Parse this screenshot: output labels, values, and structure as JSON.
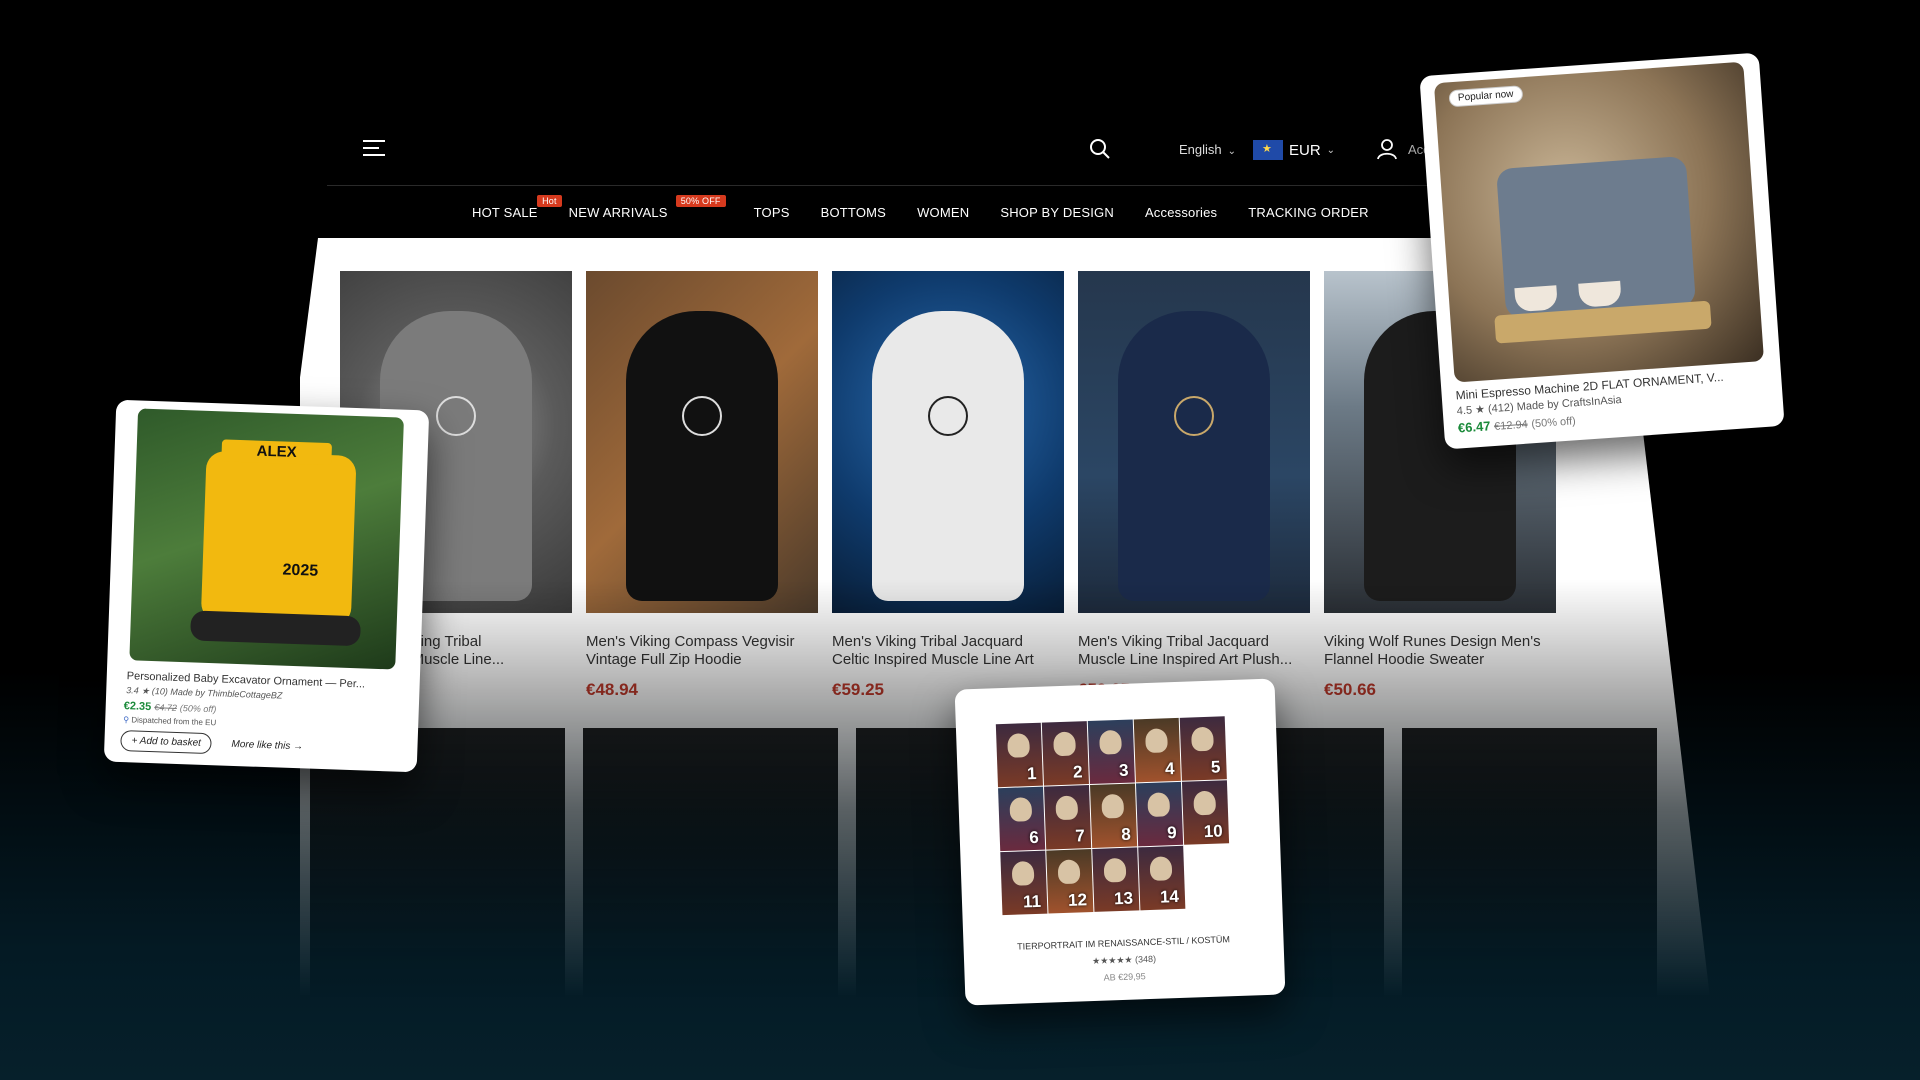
{
  "header": {
    "language": "English",
    "currency": "EUR",
    "account_label": "Acc"
  },
  "nav": {
    "items": [
      {
        "label": "HOT SALE",
        "badge": "Hot"
      },
      {
        "label": "NEW ARRIVALS",
        "badge": "50% OFF"
      },
      {
        "label": "TOPS"
      },
      {
        "label": "BOTTOMS"
      },
      {
        "label": "WOMEN"
      },
      {
        "label": "SHOP BY DESIGN"
      },
      {
        "label": "Accessories"
      },
      {
        "label": "TRACKING ORDER"
      }
    ]
  },
  "products": [
    {
      "title": "Viking Tribal\nc Muscle Line...",
      "price": ""
    },
    {
      "title": "Men's Viking Compass Vegvisir Vintage Full Zip Hoodie",
      "price": "€48.94"
    },
    {
      "title": "Men's Viking Tribal Jacquard Celtic Inspired Muscle Line Art Plush...",
      "price": "€59.25"
    },
    {
      "title": "Men's Viking Tribal Jacquard Muscle Line Inspired Art Plush...",
      "price": "€59.25"
    },
    {
      "title": "Viking Wolf Runes Design Men's Flannel Hoodie Sweater",
      "price": "€50.66"
    }
  ],
  "float_left": {
    "image_text_top": "ALEX",
    "image_text_year": "2025",
    "title": "Personalized Baby Excavator Ornament — Per...",
    "rating": "3.4",
    "reviews": "(10)",
    "maker": "Made by ThimbleCottageBZ",
    "price": "€2.35",
    "old_price": "€4.72",
    "discount": "(50% off)",
    "dispatch": "Dispatched from the EU",
    "add_button": "Add to basket",
    "more_link": "More like this"
  },
  "float_right": {
    "pill": "Popular now",
    "title": "Mini Espresso Machine 2D FLAT ORNAMENT, V...",
    "rating": "4.5",
    "reviews": "(412)",
    "maker": "Made by CraftsInAsia",
    "price": "€6.47",
    "old_price": "€12.94",
    "discount": "(50% off)"
  },
  "float_bottom": {
    "numbers": [
      "1",
      "2",
      "3",
      "4",
      "5",
      "6",
      "7",
      "8",
      "9",
      "10",
      "11",
      "12",
      "13",
      "14"
    ],
    "title": "TIERPORTRAIT IM RENAISSANCE-STIL / KOSTÜM",
    "reviews": "(348)",
    "price": "AB €29,95"
  }
}
